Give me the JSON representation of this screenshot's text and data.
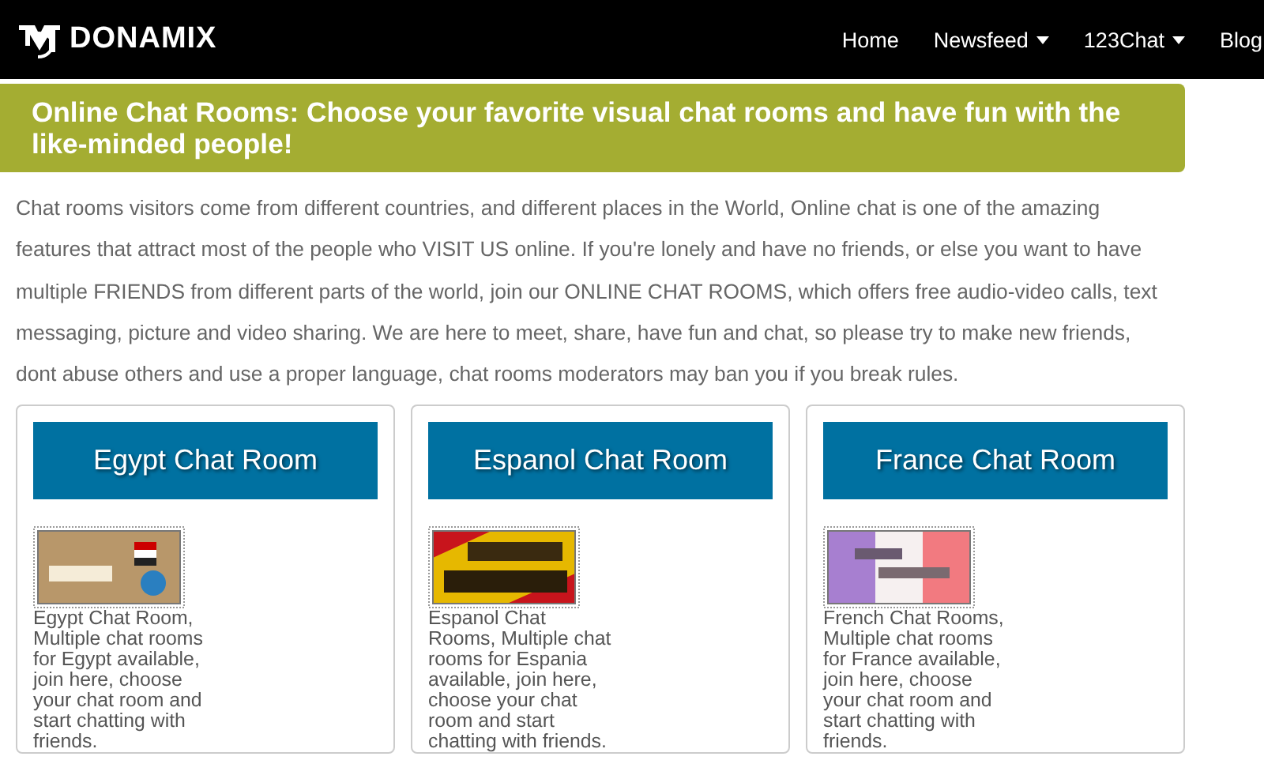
{
  "logo": {
    "text": "DONAMIX"
  },
  "nav": [
    {
      "label": "Home",
      "dropdown": false
    },
    {
      "label": "Newsfeed",
      "dropdown": true
    },
    {
      "label": "123Chat",
      "dropdown": true
    },
    {
      "label": "Blog",
      "dropdown": false
    }
  ],
  "banner": {
    "title": "Online Chat Rooms: Choose your favorite visual chat rooms and have fun with the like-minded people!"
  },
  "intro": "Chat rooms visitors come from different countries, and different places in the World, Online chat is one of the amazing features that attract most of the people who VISIT US online. If you're lonely and have no friends, or else you want to have multiple FRIENDS from different parts of the world, join our ONLINE CHAT ROOMS, which offers free audio-video calls, text messaging, picture and video sharing. We are here to meet, share, have fun and chat, so please try to make new friends, dont abuse others and use a proper language, chat rooms moderators may ban you if you break rules.",
  "rooms": [
    {
      "button": "Egypt Chat Room",
      "description": "Egypt Chat Room, Multiple chat rooms for Egypt available, join here, choose your chat room and start chatting with friends."
    },
    {
      "button": "Espanol Chat Room",
      "description": "Espanol Chat Rooms, Multiple chat rooms for Espania available, join here, choose your chat room and start chatting with friends."
    },
    {
      "button": "France Chat Room",
      "description": "French Chat Rooms, Multiple chat rooms for France available, join here, choose your chat room and start chatting with friends."
    }
  ]
}
